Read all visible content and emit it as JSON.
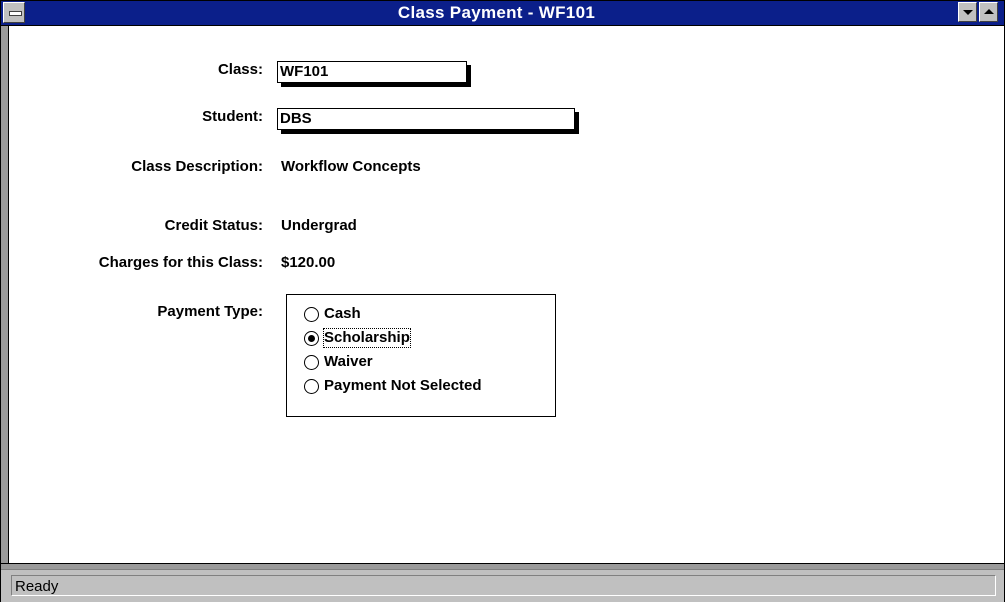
{
  "window": {
    "title": "Class Payment - WF101"
  },
  "form": {
    "class_label": "Class:",
    "class_value": "WF101",
    "student_label": "Student:",
    "student_value": "DBS",
    "description_label": "Class Description:",
    "description_value": "Workflow Concepts",
    "credit_label": "Credit Status:",
    "credit_value": "Undergrad",
    "charges_label": "Charges for this Class:",
    "charges_value": "$120.00",
    "payment_label": "Payment Type:",
    "payment_options": [
      {
        "label": "Cash",
        "selected": false
      },
      {
        "label": "Scholarship",
        "selected": true
      },
      {
        "label": "Waiver",
        "selected": false
      },
      {
        "label": "Payment Not Selected",
        "selected": false
      }
    ]
  },
  "status": {
    "text": "Ready"
  },
  "colors": {
    "titlebar": "#0b1f8a",
    "frame": "#9a9a9a",
    "chrome": "#c0c0c0"
  },
  "icons": {
    "system_menu": "system-menu-icon",
    "minimize": "minimize-icon",
    "maximize": "maximize-icon"
  }
}
